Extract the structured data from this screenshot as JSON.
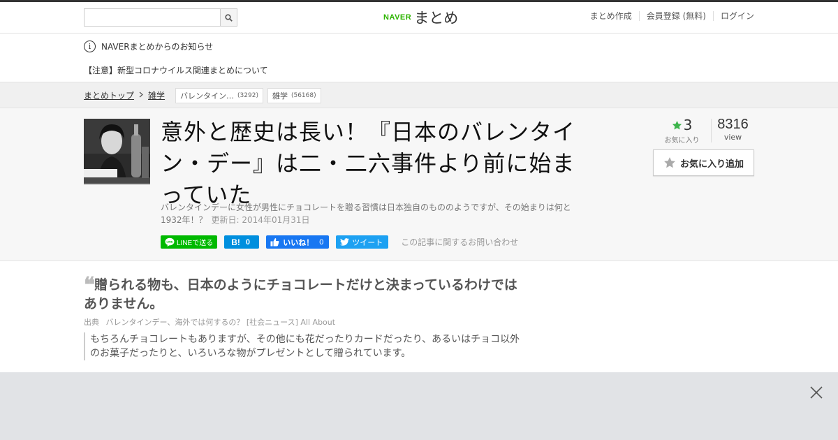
{
  "header": {
    "search": {
      "value": "",
      "placeholder": ""
    },
    "logo": {
      "brand": "NAVER",
      "name": "まとめ"
    },
    "nav": [
      "まとめ作成",
      "会員登録 (無料)",
      "ログイン"
    ]
  },
  "notice": {
    "title": "NAVERまとめからのお知らせ",
    "link": "【注意】新型コロナウイルス関連まとめについて"
  },
  "breadcrumb": {
    "top": "まとめトップ",
    "category": "雑学",
    "tags": [
      {
        "label": "バレンタイン…",
        "count": "(3292)"
      },
      {
        "label": "雑学",
        "count": "(56168)"
      }
    ]
  },
  "article": {
    "title": "意外と歴史は長い！『日本のバレンタイン・デー』は二・二六事件より前に始まっていた",
    "description": "バレンタインデーに女性が男性にチョコレートを贈る習慣は日本独自のもののようですが、その始まりは何と1932年！？",
    "updated": "更新日: 2014年01月31日",
    "share": {
      "line": "LINEで送る",
      "hatena_icon": "B!",
      "hatena_count": "0",
      "fb_label": "いいね！",
      "fb_count": "0",
      "tweet": "ツイート"
    },
    "contact": "この記事に関するお問い合わせ",
    "favorites": "3",
    "favorites_label": "お気に入り",
    "views": "8316",
    "views_label": "view",
    "fav_button": "お気に入り追加"
  },
  "content": {
    "quote_mark": "❝",
    "heading": "贈られる物も、日本のようにチョコレートだけと決まっているわけではありません。",
    "source_label": "出典",
    "source": "バレンタインデー、海外では何するの？ [社会ニュース] All About",
    "quote": "もちろんチョコレートもありますが、その他にも花だったりカードだったり、あるいはチョコ以外のお菓子だったりと、いろいろな物がプレゼントとして贈られています。"
  },
  "colors": {
    "naver_green": "#2db400",
    "star_green": "#3cb44b",
    "line_green": "#00b900",
    "hatena_blue": "#008fde",
    "fb_blue": "#1877f2",
    "twitter_blue": "#1da1f2",
    "overlay_bg": "#e1e3e6"
  }
}
